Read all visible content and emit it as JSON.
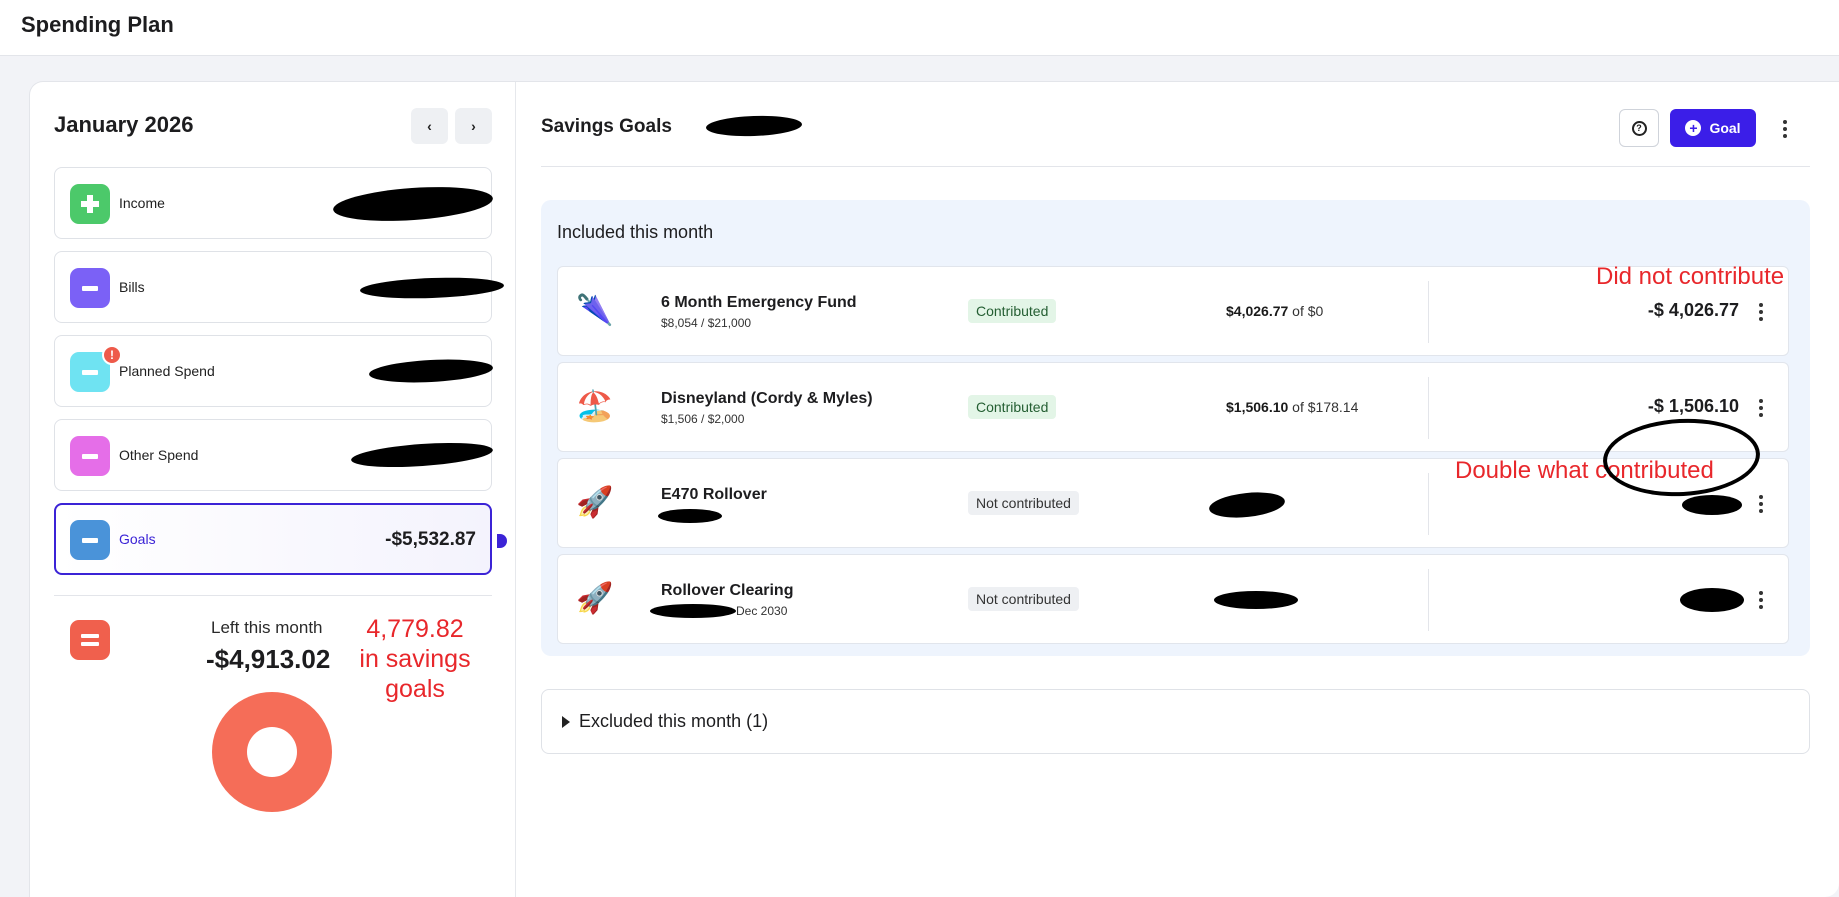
{
  "app": {
    "title": "Spending Plan"
  },
  "left": {
    "month": "January 2026",
    "prev_label": "‹",
    "next_label": "›",
    "categories": [
      {
        "label": "Income",
        "amount": "",
        "color": "#4cc96a",
        "icon": "plus-icon"
      },
      {
        "label": "Bills",
        "amount": "",
        "color": "#7b61f6",
        "icon": "minus-icon"
      },
      {
        "label": "Planned Spend",
        "amount": "",
        "color": "#6fe3f2",
        "icon": "minus-icon",
        "alert": "!"
      },
      {
        "label": "Other Spend",
        "amount": "",
        "color": "#e56ee8",
        "icon": "minus-icon"
      },
      {
        "label": "Goals",
        "amount": "-$5,532.87",
        "color": "#4a93d9",
        "icon": "minus-icon",
        "active": true
      }
    ],
    "left_this_month_label": "Left this month",
    "left_this_month_amount": "-$4,913.02",
    "summary_icon": "equals-icon",
    "summary_color": "#f0604d",
    "annotation": "4,779.82 in savings goals"
  },
  "right": {
    "title": "Savings Goals",
    "help_icon": "question-icon",
    "add_goal_label": "Goal",
    "included_title": "Included this month",
    "goals": [
      {
        "emoji": "🌂",
        "name": "6 Month Emergency Fund",
        "subtitle": "$8,054 / $21,000",
        "status": "Contributed",
        "progress_bold": "$4,026.77",
        "progress_rest": " of $0",
        "amount": "-$ 4,026.77"
      },
      {
        "emoji": "🏖️",
        "name": "Disneyland (Cordy & Myles)",
        "subtitle": "$1,506 / $2,000",
        "status": "Contributed",
        "progress_bold": "$1,506.10",
        "progress_rest": " of $178.14",
        "amount": "-$ 1,506.10"
      },
      {
        "emoji": "🚀",
        "name": "E470 Rollover",
        "subtitle": "",
        "status": "Not contributed",
        "progress_bold": "",
        "progress_rest": "",
        "amount": ""
      },
      {
        "emoji": "🚀",
        "name": "Rollover Clearing",
        "subtitle": "Dec 2030",
        "status": "Not contributed",
        "progress_bold": "",
        "progress_rest": "",
        "amount": ""
      }
    ],
    "annotation_1": "Did not contribute",
    "annotation_2": "Double what contributed",
    "excluded_label": "Excluded this month (1)"
  },
  "colors": {
    "accent": "#3b1ee8",
    "annotation": "#e8272b"
  }
}
